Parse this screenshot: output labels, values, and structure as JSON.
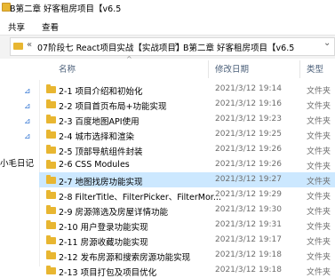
{
  "window": {
    "title": "B第二章 好客租房项目【v6.5"
  },
  "ribbon": {
    "tabs": [
      "共享",
      "查看"
    ]
  },
  "address": {
    "overflow": "«",
    "crumbs": [
      "07阶段七 React项目实战【实战项目】",
      "B第二章 好客租房项目【v6.5"
    ],
    "separator": "›",
    "dropdown": "⌄"
  },
  "sidebar": {
    "partial_label": "小毛日记"
  },
  "columns": {
    "name": "名称",
    "modified": "修改日期",
    "type": "类型",
    "sort_indicator": "^"
  },
  "rows": [
    {
      "name": "2-1 项目介绍和初始化",
      "date": "2021/3/12 19:14",
      "type": "文件夹",
      "selected": false
    },
    {
      "name": "2-2 项目首页布局+功能实现",
      "date": "2021/3/12 19:16",
      "type": "文件夹",
      "selected": false
    },
    {
      "name": "2-3 百度地图API使用",
      "date": "2021/3/12 19:23",
      "type": "文件夹",
      "selected": false
    },
    {
      "name": "2-4 城市选择和渲染",
      "date": "2021/3/12 19:25",
      "type": "文件夹",
      "selected": false
    },
    {
      "name": "2-5 顶部导航组件封装",
      "date": "2021/3/12 19:26",
      "type": "文件夹",
      "selected": false
    },
    {
      "name": "2-6 CSS Modules",
      "date": "2021/3/12 19:26",
      "type": "文件夹",
      "selected": false
    },
    {
      "name": "2-7 地图找房功能实现",
      "date": "2021/3/12 19:27",
      "type": "文件夹",
      "selected": true
    },
    {
      "name": "2-8 FilterTitle、FilterPicker、FilterMor...",
      "date": "2021/3/12 19:29",
      "type": "文件夹",
      "selected": false
    },
    {
      "name": "2-9 房源筛选及房屋详情功能",
      "date": "2021/3/12 19:30",
      "type": "文件夹",
      "selected": false
    },
    {
      "name": "2-10 用户登录功能实现",
      "date": "2021/3/12 19:31",
      "type": "文件夹",
      "selected": false
    },
    {
      "name": "2-11 房源收藏功能实现",
      "date": "2021/3/12 19:17",
      "type": "文件夹",
      "selected": false
    },
    {
      "name": "2-12 发布房源和搜索房源功能实现",
      "date": "2021/3/12 19:18",
      "type": "文件夹",
      "selected": false
    },
    {
      "name": "2-13 项目打包及项目优化",
      "date": "2021/3/12 19:18",
      "type": "文件夹",
      "selected": false
    }
  ]
}
